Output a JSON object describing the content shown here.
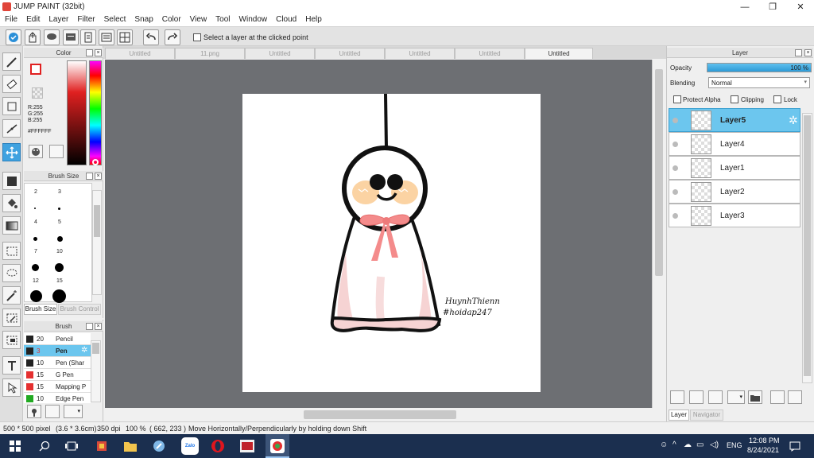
{
  "window": {
    "title": "JUMP PAINT (32bit)"
  },
  "menu": [
    "File",
    "Edit",
    "Layer",
    "Filter",
    "Select",
    "Snap",
    "Color",
    "View",
    "Tool",
    "Window",
    "Cloud",
    "Help"
  ],
  "toolbar": {
    "select_layer_label": "Select a layer at the clicked point"
  },
  "color_panel": {
    "title": "Color",
    "r": "R:255",
    "g": "G:255",
    "b": "B:255",
    "hex": "#FFFFFF"
  },
  "brush_size_panel": {
    "title": "Brush Size",
    "sizes": [
      "2",
      "3",
      "4",
      "5",
      "7",
      "10",
      "12",
      "15"
    ],
    "tab_active": "Brush Size",
    "tab_inactive": "Brush Control"
  },
  "brush_panel": {
    "title": "Brush",
    "items": [
      {
        "size": "20",
        "name": "Pencil",
        "color": "#222222"
      },
      {
        "size": "3",
        "name": "Pen",
        "color": "#222222"
      },
      {
        "size": "10",
        "name": "Pen (Shar",
        "color": "#222222"
      },
      {
        "size": "15",
        "name": "G Pen",
        "color": "#e53030"
      },
      {
        "size": "15",
        "name": "Mapping P",
        "color": "#e53030"
      },
      {
        "size": "10",
        "name": "Edge Pen",
        "color": "#22aa22"
      }
    ]
  },
  "tabs": [
    "Untitled",
    "11.png",
    "Untitled",
    "Untitled",
    "Untitled",
    "Untitled",
    "Untitled"
  ],
  "canvas": {
    "signature_line1": "HuynhThienn",
    "signature_line2": "#hoidap247"
  },
  "layer_panel": {
    "title": "Layer",
    "opacity_label": "Opacity",
    "opacity_value": "100 %",
    "opacity": 1.0,
    "blending_label": "Blending",
    "blending_value": "Normal",
    "protect_alpha": "Protect Alpha",
    "clipping": "Clipping",
    "lock": "Lock",
    "layers": [
      "Layer5",
      "Layer4",
      "Layer1",
      "Layer2",
      "Layer3"
    ],
    "bottom_tab_active": "Layer",
    "bottom_tab_inactive": "Navigator"
  },
  "status": {
    "size": "500 * 500 pixel",
    "cm": "(3.6 * 3.6cm)",
    "dpi": "350 dpi",
    "zoom": "100 %",
    "coords": "( 662, 233 )",
    "hint": "Move Horizontally/Perpendicularly by holding down Shift"
  },
  "taskbar": {
    "lang": "ENG",
    "time": "12:08 PM",
    "date": "8/24/2021",
    "zalo": "Zalo",
    "up": "^"
  },
  "colors": {
    "accent": "#3fa2e0",
    "selected_layer": "#6cc6ee",
    "taskbar": "#1b2f4f",
    "canvas_bg": "#6d6f73"
  }
}
